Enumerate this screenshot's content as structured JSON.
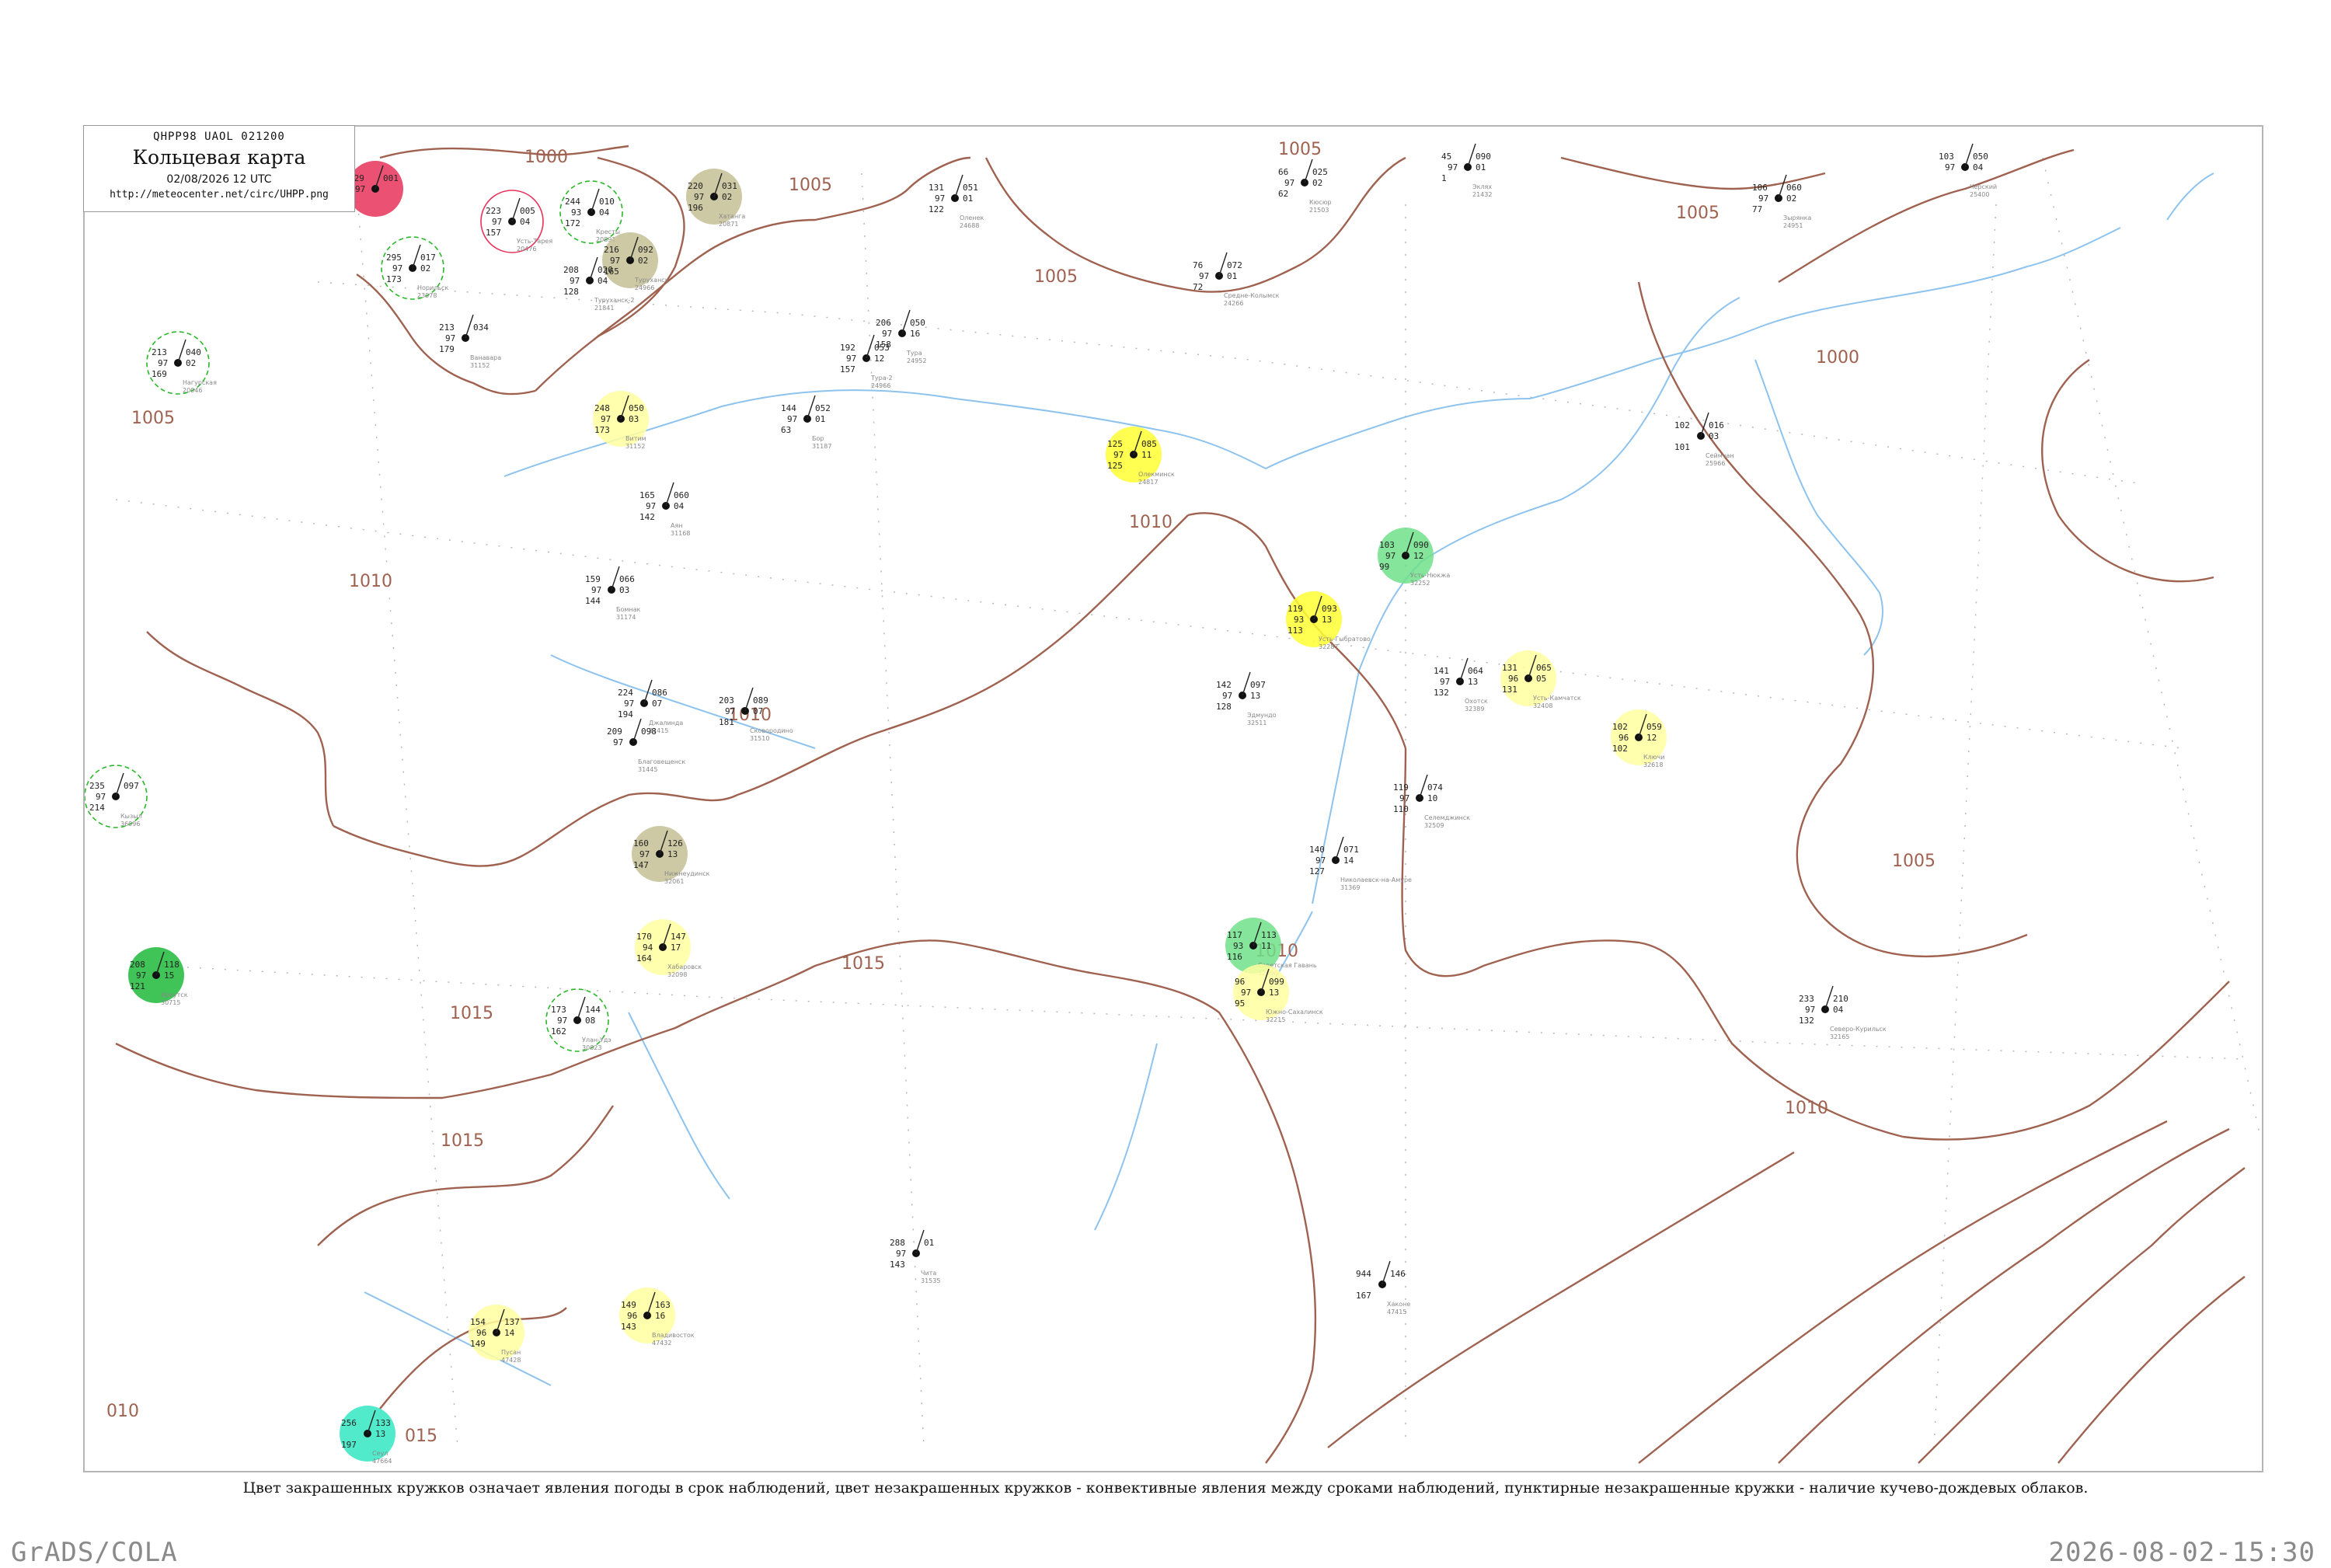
{
  "header": {
    "code": "QHPP98  UAOL  021200",
    "title": "Кольцевая карта",
    "date": "02/08/2026 12 UTC",
    "url": "http://meteocenter.net/circ/UHPP.png"
  },
  "caption": "Цвет закрашенных кружков означает явления погоды в срок наблюдений, цвет незакрашенных кружков - конвективные явления между сроками наблюдений, пунктирные незакрашенные кружки - наличие кучево-дождевых облаков.",
  "footer": {
    "left": "GrADS/COLA",
    "right": "2026-08-02-15:30"
  },
  "colors": {
    "isobar": "#a06250",
    "coast": "#8ec3ee",
    "thunderstorm": "#e8325a",
    "rain": "#6fe08a",
    "rain_heavy": "#1fb83a",
    "fog": "#ffff33",
    "haze": "#ffffa0",
    "smoke": "#c4bf94",
    "shower": "#33e8c2",
    "cb_ring": "#28b828"
  },
  "isobar_labels": [
    {
      "text": "1000"
    },
    {
      "text": "1005"
    },
    {
      "text": "1005"
    },
    {
      "text": "1005"
    },
    {
      "text": "1005"
    },
    {
      "text": "1000"
    },
    {
      "text": "1010"
    },
    {
      "text": "1010"
    },
    {
      "text": "1010"
    },
    {
      "text": "1015"
    },
    {
      "text": "1015"
    },
    {
      "text": "1015"
    },
    {
      "text": "1010"
    },
    {
      "text": "1005"
    },
    {
      "text": "1010"
    },
    {
      "text": "1005"
    },
    {
      "text": "010"
    },
    {
      "text": "015"
    }
  ],
  "stations": [
    {
      "name": "",
      "t": "229",
      "p": "001",
      "v": "97",
      "tend": "",
      "dew": "",
      "id": ""
    },
    {
      "name": "Нагурская",
      "t": "213",
      "p": "040",
      "v": "97",
      "tend": "02",
      "dew": "169",
      "id": "20046"
    },
    {
      "name": "Усть-Тарея",
      "t": "223",
      "p": "005",
      "v": "97",
      "tend": "04",
      "dew": "157",
      "id": "20476"
    },
    {
      "name": "Кресты",
      "t": "244",
      "p": "010",
      "v": "93",
      "tend": "04",
      "dew": "172",
      "id": "20891"
    },
    {
      "name": "Хатанга",
      "t": "220",
      "p": "031",
      "v": "97",
      "tend": "02",
      "dew": "196",
      "id": "20871"
    },
    {
      "name": "Оленек",
      "t": "131",
      "p": "051",
      "v": "97",
      "tend": "01",
      "dew": "122",
      "id": "24688"
    },
    {
      "name": "Кюсюр",
      "t": "66",
      "p": "025",
      "v": "97",
      "tend": "02",
      "dew": "62",
      "id": "21503"
    },
    {
      "name": "Эклях",
      "t": "45",
      "p": "090",
      "v": "97",
      "tend": "01",
      "dew": "1",
      "id": "21432"
    },
    {
      "name": "Черский",
      "t": "103",
      "p": "050",
      "v": "97",
      "tend": "04",
      "dew": "",
      "id": "25400"
    },
    {
      "name": "Зырянка",
      "t": "106",
      "p": "060",
      "v": "97",
      "tend": "02",
      "dew": "77",
      "id": "24951"
    },
    {
      "name": "Норильск",
      "t": "295",
      "p": "017",
      "v": "97",
      "tend": "02",
      "dew": "173",
      "id": "23078"
    },
    {
      "name": "Туруханск",
      "t": "216",
      "p": "092",
      "v": "97",
      "tend": "02",
      "dew": "165",
      "id": "24966"
    },
    {
      "name": "Туруханск-2",
      "t": "208",
      "p": "020",
      "v": "97",
      "tend": "04",
      "dew": "128",
      "id": "21841"
    },
    {
      "name": "Ванавара",
      "t": "213",
      "p": "034",
      "v": "97",
      "tend": "",
      "dew": "179",
      "id": "31152"
    },
    {
      "name": "Тура",
      "t": "206",
      "p": "050",
      "v": "97",
      "tend": "16",
      "dew": "158",
      "id": "24952"
    },
    {
      "name": "Тура-2",
      "t": "192",
      "p": "053",
      "v": "97",
      "tend": "12",
      "dew": "157",
      "id": "24966"
    },
    {
      "name": "Бор",
      "t": "144",
      "p": "052",
      "v": "97",
      "tend": "01",
      "dew": "63",
      "id": "31187"
    },
    {
      "name": "Средне-Колымск",
      "t": "76",
      "p": "072",
      "v": "97",
      "tend": "01",
      "dew": "72",
      "id": "24266"
    },
    {
      "name": "Витим",
      "t": "248",
      "p": "050",
      "v": "97",
      "tend": "03",
      "dew": "173",
      "id": "31152"
    },
    {
      "name": "Олекминск",
      "t": "125",
      "p": "085",
      "v": "97",
      "tend": "11",
      "dew": "125",
      "id": "24817"
    },
    {
      "name": "Аян",
      "t": "165",
      "p": "060",
      "v": "97",
      "tend": "04",
      "dew": "142",
      "id": "31168"
    },
    {
      "name": "Бомнак",
      "t": "159",
      "p": "066",
      "v": "97",
      "tend": "03",
      "dew": "144",
      "id": "31174"
    },
    {
      "name": "Усть-Нюкжа",
      "t": "103",
      "p": "090",
      "v": "97",
      "tend": "12",
      "dew": "99",
      "id": "32252"
    },
    {
      "name": "Усть-Гыбратово",
      "t": "119",
      "p": "093",
      "v": "93",
      "tend": "13",
      "dew": "113",
      "id": "32287"
    },
    {
      "name": "Сеймчан",
      "t": "102",
      "p": "016",
      "v": "",
      "tend": "03",
      "dew": "101",
      "id": "25966"
    },
    {
      "name": "Охотск",
      "t": "141",
      "p": "064",
      "v": "97",
      "tend": "13",
      "dew": "132",
      "id": "32389"
    },
    {
      "name": "Усть-Камчатск",
      "t": "131",
      "p": "065",
      "v": "96",
      "tend": "05",
      "dew": "131",
      "id": "32408"
    },
    {
      "name": "Ключи",
      "t": "102",
      "p": "059",
      "v": "96",
      "tend": "12",
      "dew": "102",
      "id": "32618"
    },
    {
      "name": "Эдмундо",
      "t": "142",
      "p": "097",
      "v": "97",
      "tend": "13",
      "dew": "128",
      "id": "32511"
    },
    {
      "name": "Джалинда",
      "t": "224",
      "p": "086",
      "v": "97",
      "tend": "07",
      "dew": "194",
      "id": "31415"
    },
    {
      "name": "Сковородино",
      "t": "203",
      "p": "089",
      "v": "97",
      "tend": "07",
      "dew": "181",
      "id": "31510"
    },
    {
      "name": "Благовещенск",
      "t": "209",
      "p": "098",
      "v": "97",
      "tend": "",
      "dew": "",
      "id": "31445"
    },
    {
      "name": "Селемджинск",
      "t": "119",
      "p": "074",
      "v": "97",
      "tend": "10",
      "dew": "110",
      "id": "32509"
    },
    {
      "name": "Николаевск-на-Амуре",
      "t": "140",
      "p": "071",
      "v": "97",
      "tend": "14",
      "dew": "127",
      "id": "31369"
    },
    {
      "name": "Советская Гавань",
      "t": "117",
      "p": "113",
      "v": "93",
      "tend": "11",
      "dew": "116",
      "id": "32098"
    },
    {
      "name": "Нижнеудинск",
      "t": "160",
      "p": "126",
      "v": "97",
      "tend": "13",
      "dew": "147",
      "id": "32061"
    },
    {
      "name": "Хабаровск",
      "t": "170",
      "p": "147",
      "v": "94",
      "tend": "17",
      "dew": "164",
      "id": "32098"
    },
    {
      "name": "Южно-Сахалинск",
      "t": "96",
      "p": "099",
      "v": "97",
      "tend": "13",
      "dew": "95",
      "id": "32215"
    },
    {
      "name": "Северо-Курильск",
      "t": "233",
      "p": "210",
      "v": "97",
      "tend": "04",
      "dew": "132",
      "id": "32165"
    },
    {
      "name": "Иркутск",
      "t": "208",
      "p": "118",
      "v": "97",
      "tend": "15",
      "dew": "121",
      "id": "30715"
    },
    {
      "name": "Кызыл",
      "t": "235",
      "p": "097",
      "v": "97",
      "tend": "",
      "dew": "214",
      "id": "36096"
    },
    {
      "name": "Улан-Удэ",
      "t": "173",
      "p": "144",
      "v": "97",
      "tend": "08",
      "dew": "162",
      "id": "30823"
    },
    {
      "name": "Владивосток",
      "t": "149",
      "p": "163",
      "v": "96",
      "tend": "16",
      "dew": "143",
      "id": "47432"
    },
    {
      "name": "Пусан",
      "t": "154",
      "p": "137",
      "v": "96",
      "tend": "14",
      "dew": "149",
      "id": "47428"
    },
    {
      "name": "Сеул",
      "t": "256",
      "p": "133",
      "v": "",
      "tend": "13",
      "dew": "197",
      "id": "47664"
    },
    {
      "name": "Читa",
      "t": "288",
      "p": "01",
      "v": "97",
      "tend": "",
      "dew": "143",
      "id": "31535"
    },
    {
      "name": "Хаконе",
      "t": "944",
      "p": "146",
      "v": "",
      "tend": "",
      "dew": "167",
      "id": "47415"
    }
  ]
}
